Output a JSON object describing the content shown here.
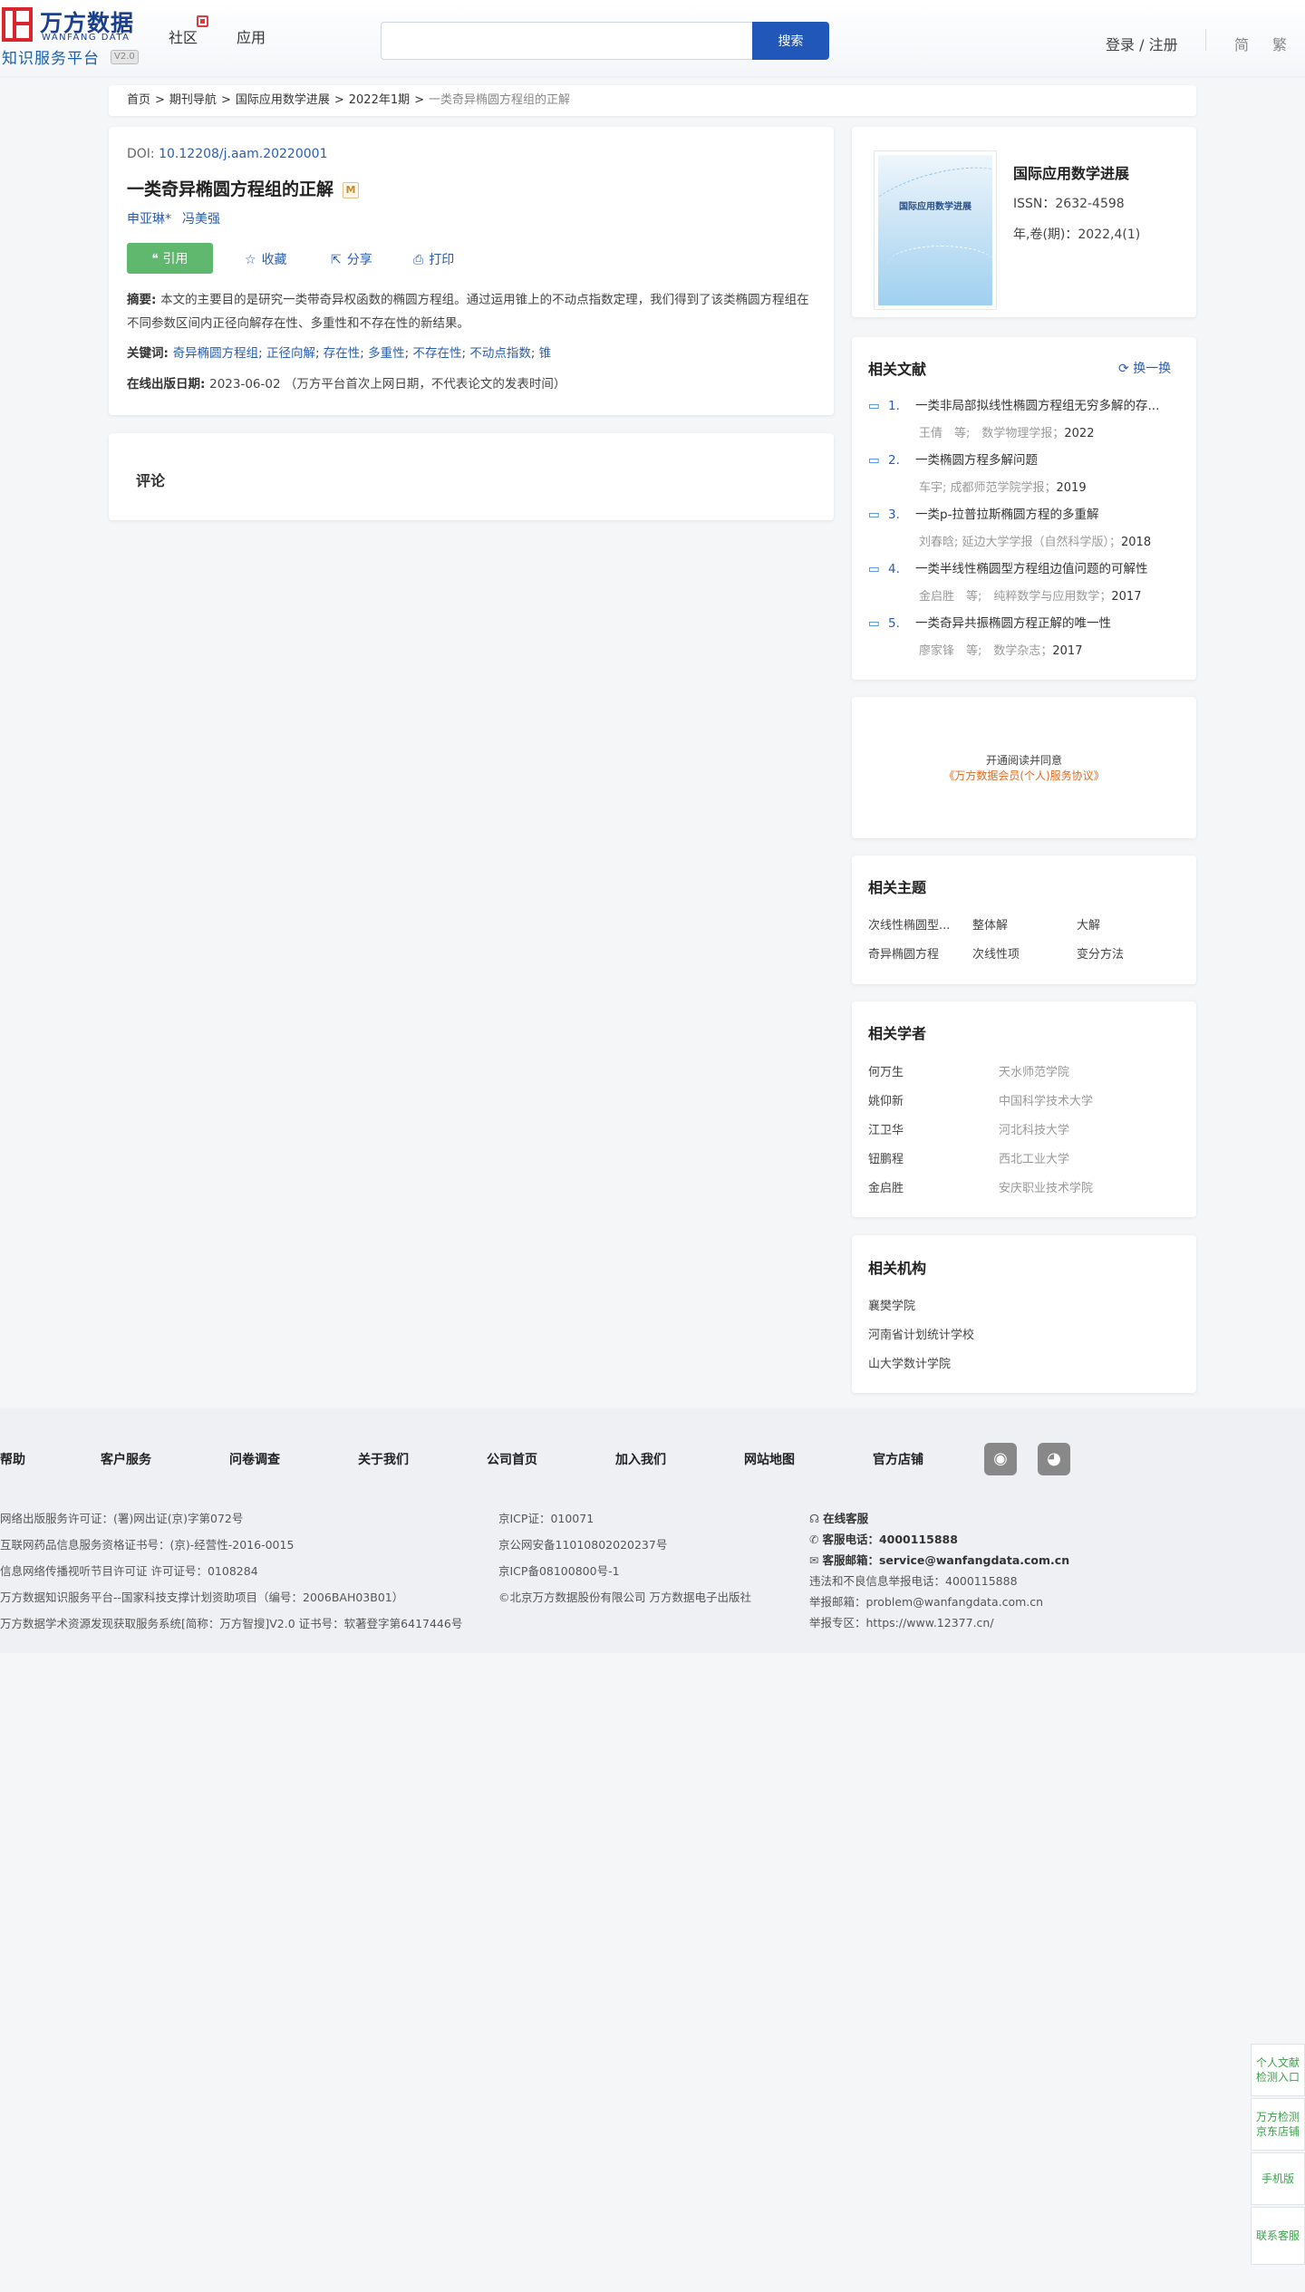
{
  "header": {
    "logo_cn": "万方数据",
    "logo_en": "WANFANG DATA",
    "logo_sub": "知识服务平台",
    "logo_version": "V2.0",
    "nav": [
      "社区",
      "应用"
    ],
    "search_placeholder": "",
    "search_button": "搜索",
    "login": "登录 / 注册",
    "lang": [
      "简",
      "繁"
    ]
  },
  "breadcrumb": [
    "首页",
    "期刊导航",
    "国际应用数学进展",
    "2022年1期",
    "一类奇异椭圆方程组的正解"
  ],
  "article": {
    "doi_label": "DOI: ",
    "doi": "10.12208/j.aam.20220001",
    "title": "一类奇异椭圆方程组的正解",
    "badge": "M",
    "authors": [
      "申亚琳*",
      "冯美强"
    ],
    "actions": {
      "cite": "引用",
      "favorite": "收藏",
      "share": "分享",
      "print": "打印"
    },
    "abstract_label": "摘要: ",
    "abstract": "本文的主要目的是研究一类带奇异权函数的椭圆方程组。通过运用锥上的不动点指数定理，我们得到了该类椭圆方程组在不同参数区间内正径向解存在性、多重性和不存在性的新结果。",
    "keywords_label": "关键词: ",
    "keywords": [
      "奇异椭圆方程组",
      "正径向解",
      "存在性",
      "多重性",
      "不存在性",
      "不动点指数",
      "锥"
    ],
    "date_label": "在线出版日期: ",
    "date": "2023-06-02",
    "date_note": "（万方平台首次上网日期，不代表论文的发表时间）"
  },
  "comment": {
    "title": "评论"
  },
  "journal": {
    "cover_title": "国际应用数学进展",
    "name": "国际应用数学进展",
    "issn": "ISSN：2632-4598",
    "volume": "年,卷(期)：2022,4(1)"
  },
  "related_docs": {
    "title": "相关文献",
    "swap": "换一换",
    "items": [
      {
        "num": "1.",
        "title": "一类非局部拟线性椭圆方程组无穷多解的存...",
        "meta": "王倩　等;　数学物理学报；",
        "year": "2022"
      },
      {
        "num": "2.",
        "title": "一类椭圆方程多解问题",
        "meta": "车宇; 成都师范学院学报；",
        "year": "2019"
      },
      {
        "num": "3.",
        "title": "一类p-拉普拉斯椭圆方程的多重解",
        "meta": "刘春晗; 延边大学学报（自然科学版）；",
        "year": "2018"
      },
      {
        "num": "4.",
        "title": "一类半线性椭圆型方程组边值问题的可解性",
        "meta": "金启胜　等;　纯粹数学与应用数学；",
        "year": "2017"
      },
      {
        "num": "5.",
        "title": "一类奇异共振椭圆方程正解的唯一性",
        "meta": "廖家锋　等;　数学杂志；",
        "year": "2017"
      }
    ]
  },
  "promo": {
    "line1": "开通阅读并同意",
    "line2": "《万方数据会员(个人)服务协议》"
  },
  "topics": {
    "title": "相关主题",
    "items": [
      "次线性椭圆型...",
      "整体解",
      "大解",
      "奇异椭圆方程",
      "次线性项",
      "变分方法"
    ]
  },
  "scholars": {
    "title": "相关学者",
    "items": [
      {
        "name": "何万生",
        "aff": "天水师范学院"
      },
      {
        "name": "姚仰新",
        "aff": "中国科学技术大学"
      },
      {
        "name": "江卫华",
        "aff": "河北科技大学"
      },
      {
        "name": "钮鹏程",
        "aff": "西北工业大学"
      },
      {
        "name": "金启胜",
        "aff": "安庆职业技术学院"
      }
    ]
  },
  "orgs": {
    "title": "相关机构",
    "items": [
      "襄樊学院",
      "河南省计划统计学校",
      "山大学数计学院"
    ]
  },
  "footer": {
    "links": [
      "帮助",
      "客户服务",
      "问卷调查",
      "关于我们",
      "公司首页",
      "加入我们",
      "网站地图",
      "官方店铺"
    ],
    "col1": [
      "网络出版服务许可证：(署)网出证(京)字第072号",
      "互联网药品信息服务资格证书号：(京)-经营性-2016-0015",
      "信息网络传播视听节目许可证 许可证号：0108284",
      "万方数据知识服务平台--国家科技支撑计划资助项目（编号：2006BAH03B01）",
      "万方数据学术资源发现获取服务系统[简称：万方智搜]V2.0 证书号：软著登字第6417446号"
    ],
    "col2": [
      "京ICP证：010071",
      "京公网安备11010802020237号",
      "京ICP备08100800号-1",
      "©北京万方数据股份有限公司 万方数据电子出版社"
    ],
    "online": "在线客服",
    "phone_label": "客服电话：",
    "phone": "4000115888",
    "email_label": "客服邮箱：",
    "email": "service@wanfangdata.com.cn",
    "report_phone": "违法和不良信息举报电话：4000115888",
    "report_email": "举报邮箱：problem@wanfangdata.com.cn",
    "report_site": "举报专区：https://www.12377.cn/"
  },
  "float": {
    "items": [
      "个人文献检测入口",
      "万方检测京东店铺",
      "手机版",
      "联系客服"
    ]
  }
}
